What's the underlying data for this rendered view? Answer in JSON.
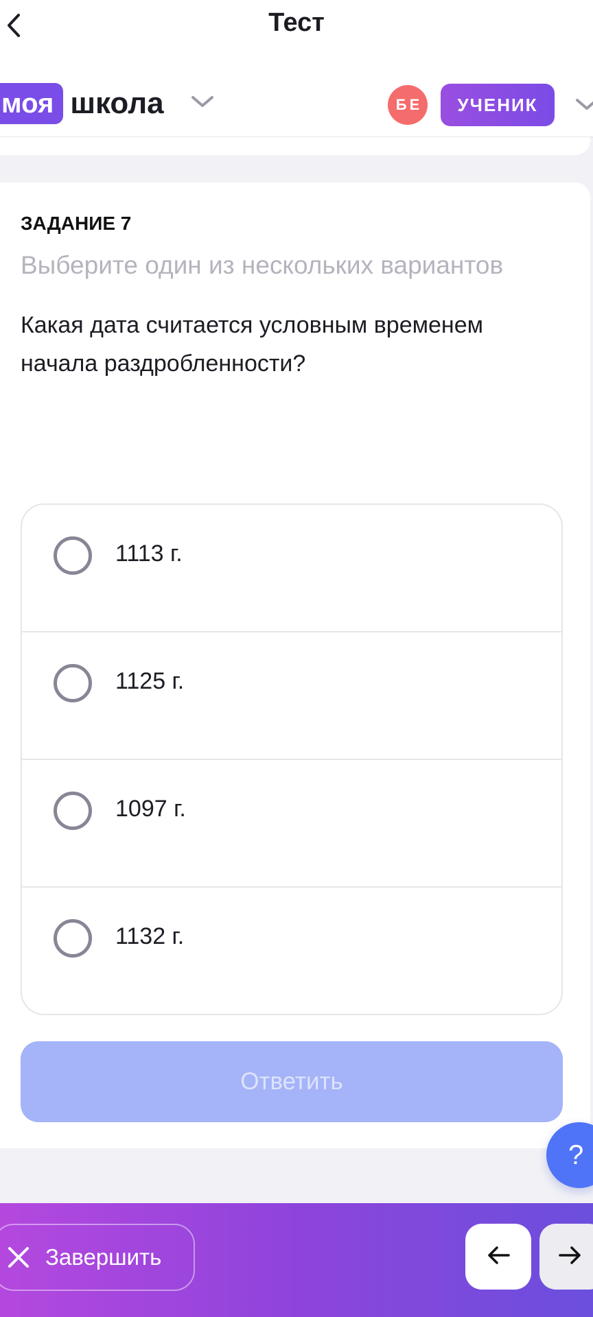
{
  "header": {
    "title": "Тест",
    "brand_moya": "моя",
    "brand_shkola": "школа",
    "avatar_initials": "БЕ",
    "role": "УЧЕНИК"
  },
  "task": {
    "label": "ЗАДАНИЕ 7",
    "hint": "Выберите один из нескольких вариантов",
    "question": "Какая дата считается условным временем начала раздробленности?",
    "options": [
      {
        "label": "1113 г.",
        "selected": false
      },
      {
        "label": "1125 г.",
        "selected": false
      },
      {
        "label": "1097 г.",
        "selected": false
      },
      {
        "label": "1132 г.",
        "selected": false
      }
    ],
    "answer_button": "Ответить"
  },
  "help": {
    "label": "?"
  },
  "footer": {
    "finish_label": "Завершить"
  },
  "colors": {
    "brand_purple": "#7a4de8",
    "avatar_red": "#f56c6c",
    "answer_disabled": "#a5b3f8",
    "help_blue": "#4f74f7"
  },
  "icons": {
    "back": "chevron-left-icon",
    "school_dropdown": "chevron-down-icon",
    "role_dropdown": "chevron-down-icon",
    "finish": "close-icon",
    "prev": "arrow-left-icon",
    "next": "arrow-right-icon"
  }
}
